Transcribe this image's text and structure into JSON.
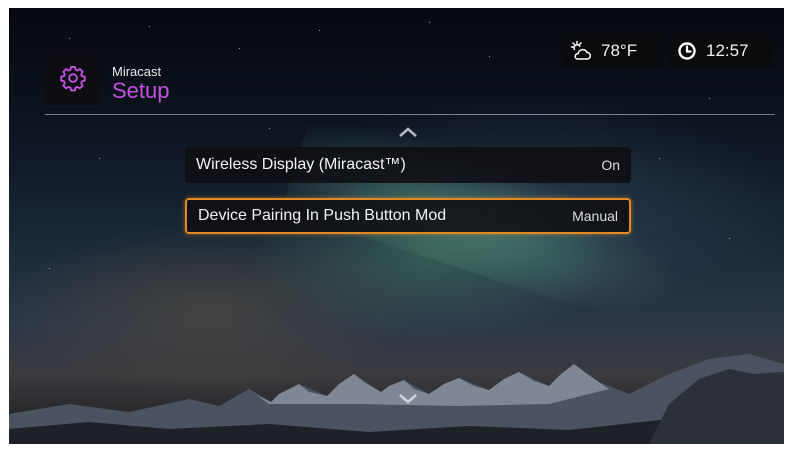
{
  "header": {
    "section_label": "Miracast",
    "title": "Setup",
    "logo_icon": "gear-icon"
  },
  "status": {
    "weather_icon": "partly-cloudy-icon",
    "temperature": "78°F",
    "clock_icon": "clock-icon",
    "time": "12:57"
  },
  "menu": {
    "items": [
      {
        "label": "Wireless Display (Miracast™)",
        "value": "On",
        "selected": false
      },
      {
        "label": "Device Pairing In Push Button Mod",
        "value": "Manual",
        "selected": true
      }
    ]
  },
  "colors": {
    "accent": "#c152e0",
    "selection_border": "#e08a25"
  }
}
